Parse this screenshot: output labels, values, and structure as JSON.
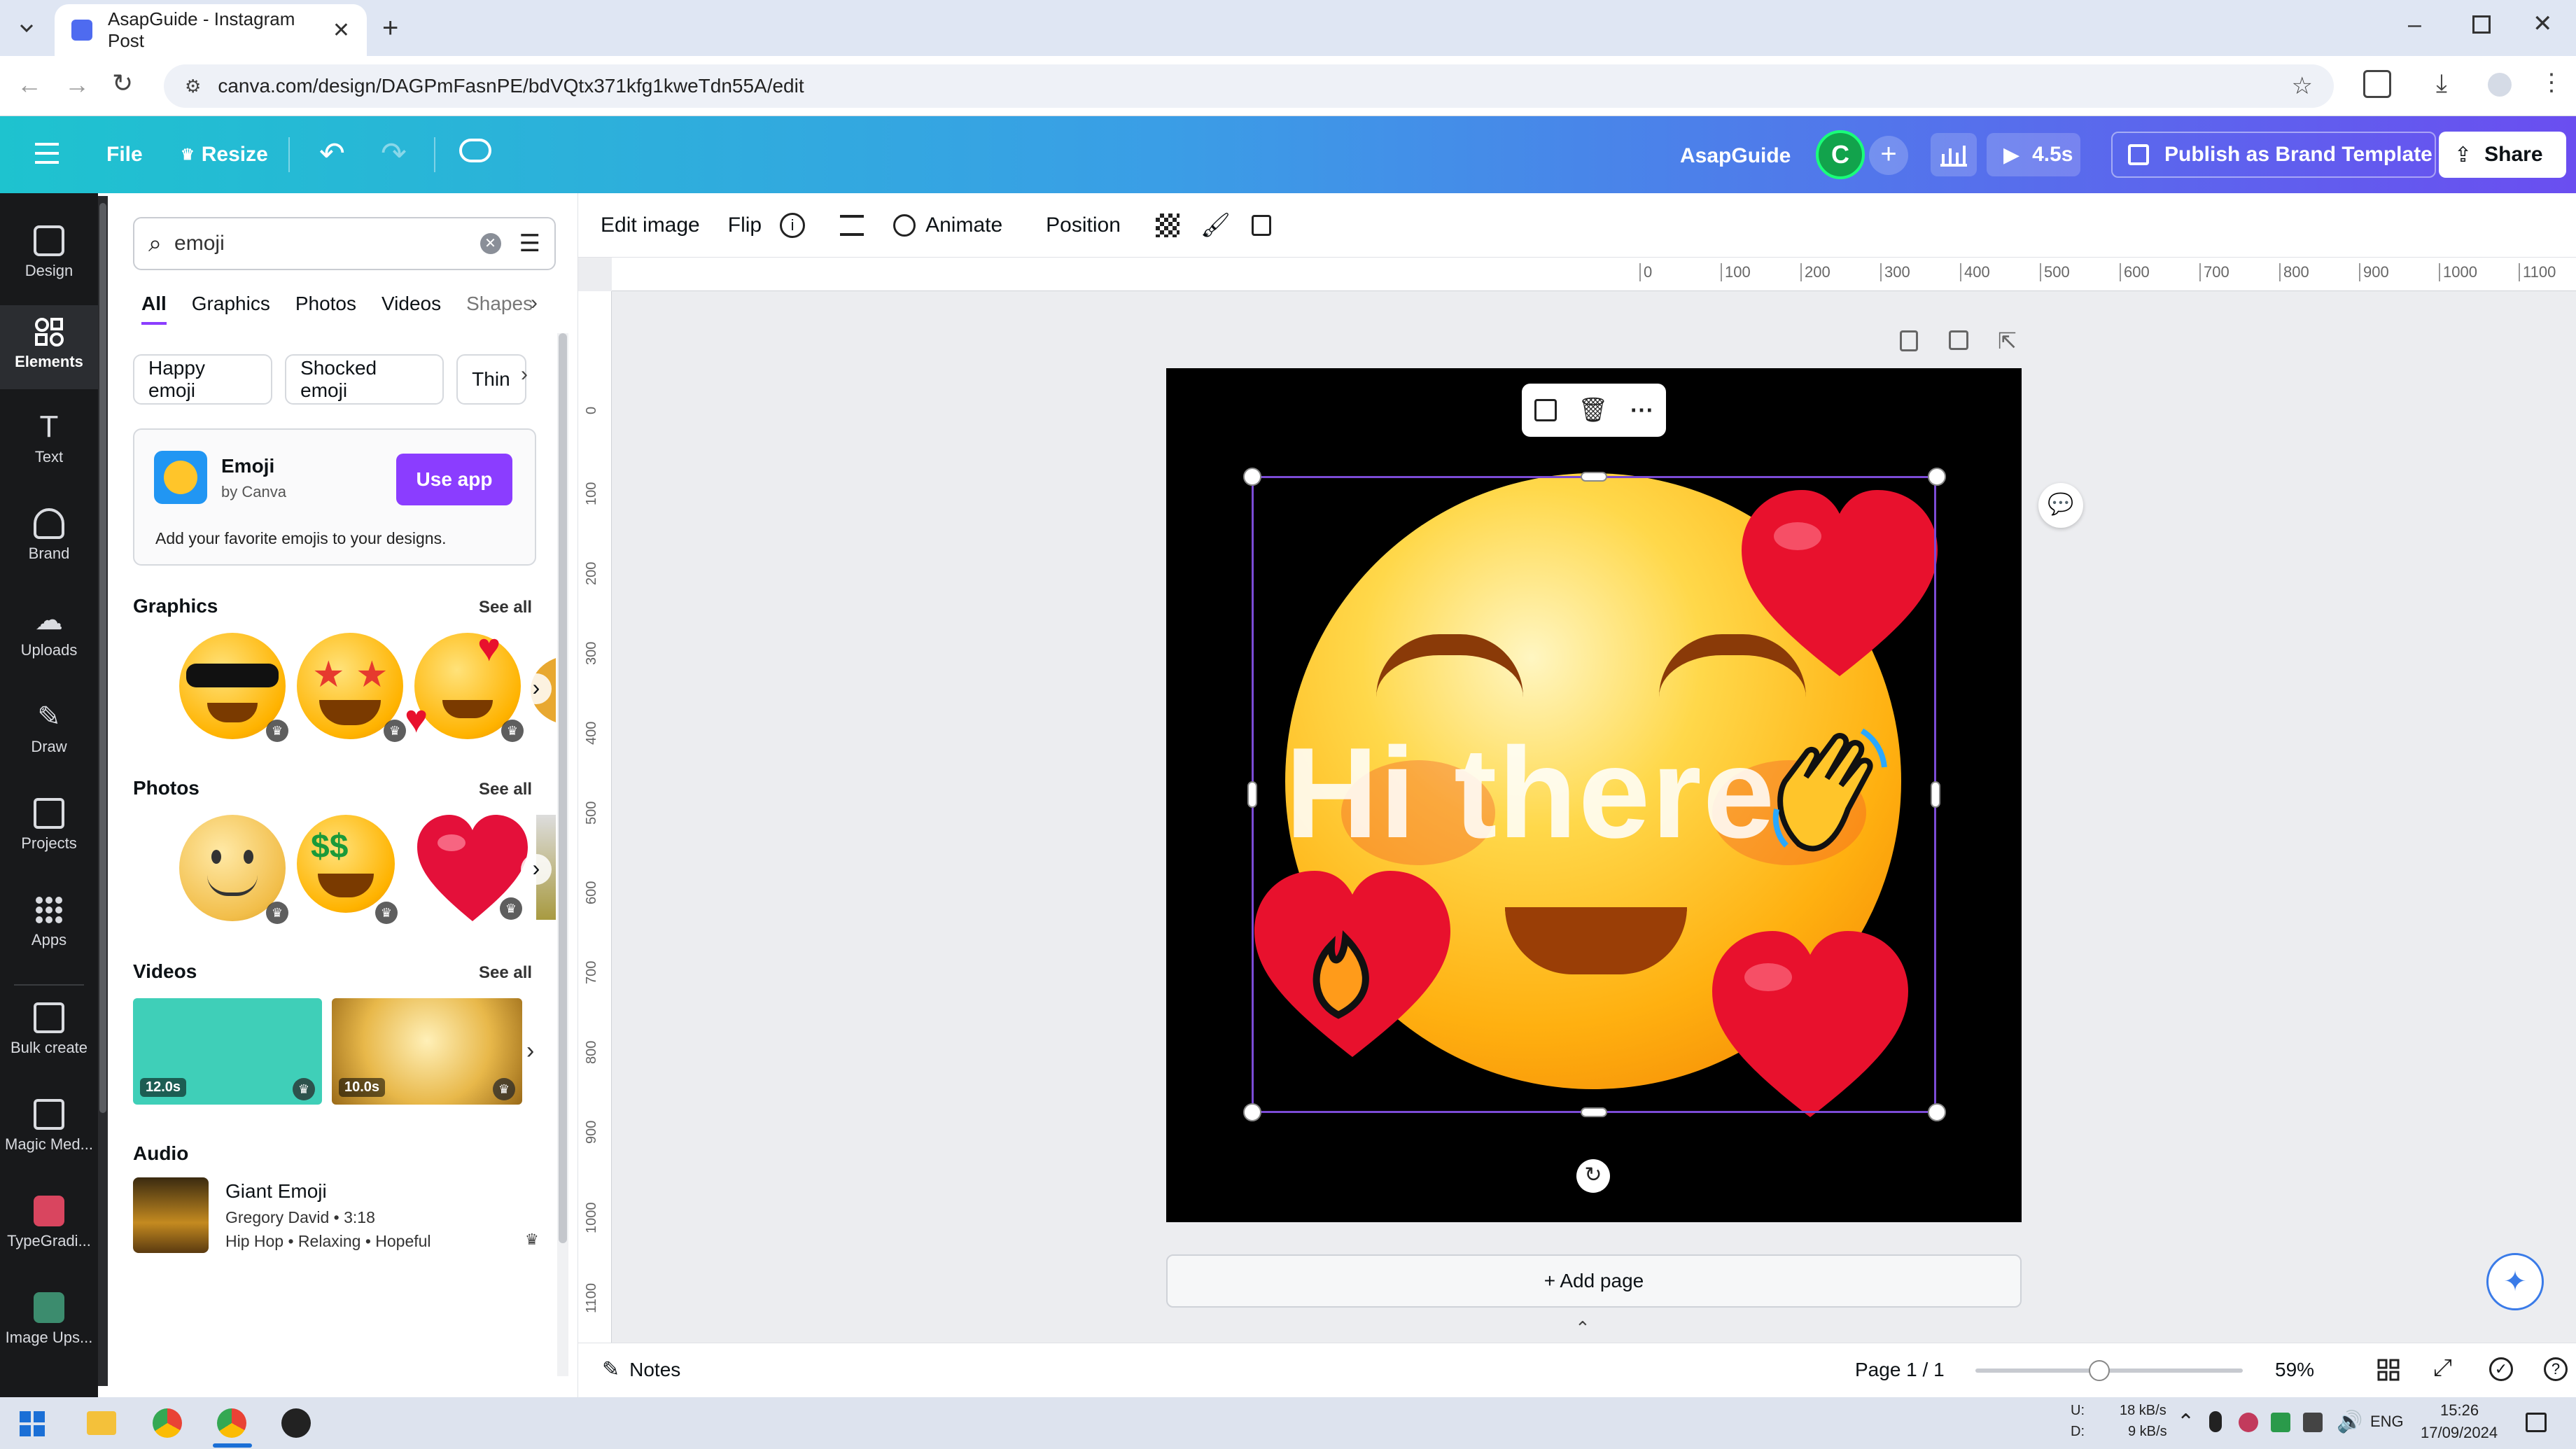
{
  "browser": {
    "tab_title": "AsapGuide - Instagram Post",
    "url": "canva.com/design/DAGPmFasnPE/bdVQtx371kfg1kweTdn55A/edit"
  },
  "header": {
    "file": "File",
    "resize": "Resize",
    "brand_name": "AsapGuide",
    "avatar_letter": "C",
    "play_duration": "4.5s",
    "publish": "Publish as Brand Template",
    "share": "Share"
  },
  "rail": {
    "items": [
      {
        "label": "Design"
      },
      {
        "label": "Elements"
      },
      {
        "label": "Text"
      },
      {
        "label": "Brand"
      },
      {
        "label": "Uploads"
      },
      {
        "label": "Draw"
      },
      {
        "label": "Projects"
      },
      {
        "label": "Apps"
      },
      {
        "label": "Bulk create"
      },
      {
        "label": "Magic Med..."
      },
      {
        "label": "TypeGradi..."
      },
      {
        "label": "Image Ups..."
      }
    ]
  },
  "panel": {
    "search_value": "emoji",
    "tabs": [
      "All",
      "Graphics",
      "Photos",
      "Videos",
      "Shapes"
    ],
    "chips": [
      "Happy emoji",
      "Shocked emoji",
      "Thin"
    ],
    "app_card": {
      "name": "Emoji",
      "by": "by Canva",
      "button": "Use app",
      "description": "Add your favorite emojis to your designs."
    },
    "graphics_title": "Graphics",
    "photos_title": "Photos",
    "videos_title": "Videos",
    "audio_title": "Audio",
    "see_all": "See all",
    "videos": [
      {
        "duration": "12.0s",
        "color": "#3fcfb8"
      },
      {
        "duration": "10.0s",
        "color": "#e8b84a"
      }
    ],
    "audio": {
      "title": "Giant Emoji",
      "meta": "Gregory David • 3:18",
      "tags": "Hip Hop • Relaxing • Hopeful"
    }
  },
  "toolbar": {
    "edit_image": "Edit image",
    "flip": "Flip",
    "animate": "Animate",
    "position": "Position"
  },
  "ruler": {
    "h_ticks": [
      "0",
      "100",
      "200",
      "300",
      "400",
      "500",
      "600",
      "700",
      "800",
      "900",
      "1000",
      "1100"
    ],
    "v_ticks": [
      "0",
      "100",
      "200",
      "300",
      "400",
      "500",
      "600",
      "700",
      "800",
      "900",
      "1000",
      "1100"
    ]
  },
  "canvas": {
    "overlay_text": "Hi there",
    "add_page": "+ Add page"
  },
  "bottom": {
    "notes": "Notes",
    "page": "Page 1 / 1",
    "zoom": "59%"
  },
  "taskbar": {
    "net_up": "18 kB/s",
    "net_down": "9 kB/s",
    "net_up_label": "U:",
    "net_down_label": "D:",
    "lang": "ENG",
    "time": "15:26",
    "date": "17/09/2024"
  },
  "colors": {
    "accent": "#8b3dff",
    "heart": "#e8112d",
    "emoji_yellow": "#ffc52a"
  }
}
